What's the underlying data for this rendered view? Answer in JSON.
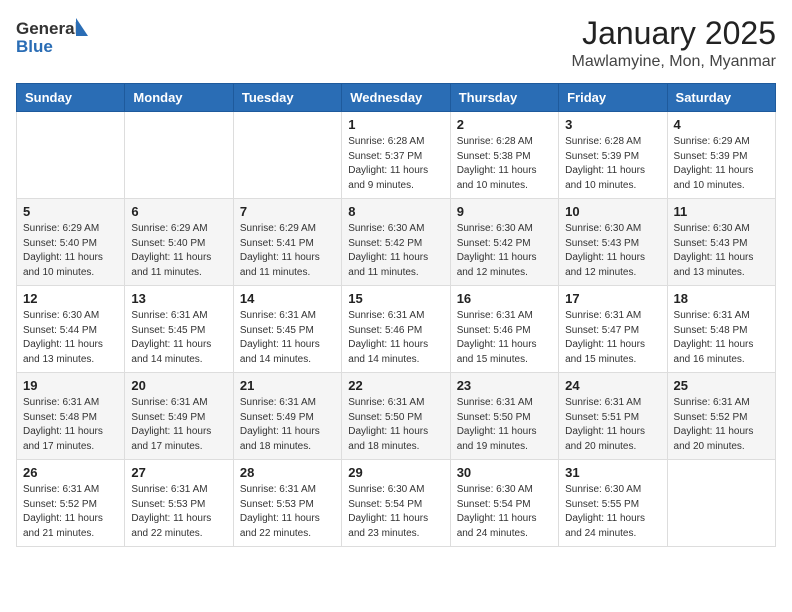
{
  "header": {
    "logo_general": "General",
    "logo_blue": "Blue",
    "month_title": "January 2025",
    "location": "Mawlamyine, Mon, Myanmar"
  },
  "weekdays": [
    "Sunday",
    "Monday",
    "Tuesday",
    "Wednesday",
    "Thursday",
    "Friday",
    "Saturday"
  ],
  "weeks": [
    [
      {
        "day": "",
        "sunrise": "",
        "sunset": "",
        "daylight": ""
      },
      {
        "day": "",
        "sunrise": "",
        "sunset": "",
        "daylight": ""
      },
      {
        "day": "",
        "sunrise": "",
        "sunset": "",
        "daylight": ""
      },
      {
        "day": "1",
        "sunrise": "Sunrise: 6:28 AM",
        "sunset": "Sunset: 5:37 PM",
        "daylight": "Daylight: 11 hours and 9 minutes."
      },
      {
        "day": "2",
        "sunrise": "Sunrise: 6:28 AM",
        "sunset": "Sunset: 5:38 PM",
        "daylight": "Daylight: 11 hours and 10 minutes."
      },
      {
        "day": "3",
        "sunrise": "Sunrise: 6:28 AM",
        "sunset": "Sunset: 5:39 PM",
        "daylight": "Daylight: 11 hours and 10 minutes."
      },
      {
        "day": "4",
        "sunrise": "Sunrise: 6:29 AM",
        "sunset": "Sunset: 5:39 PM",
        "daylight": "Daylight: 11 hours and 10 minutes."
      }
    ],
    [
      {
        "day": "5",
        "sunrise": "Sunrise: 6:29 AM",
        "sunset": "Sunset: 5:40 PM",
        "daylight": "Daylight: 11 hours and 10 minutes."
      },
      {
        "day": "6",
        "sunrise": "Sunrise: 6:29 AM",
        "sunset": "Sunset: 5:40 PM",
        "daylight": "Daylight: 11 hours and 11 minutes."
      },
      {
        "day": "7",
        "sunrise": "Sunrise: 6:29 AM",
        "sunset": "Sunset: 5:41 PM",
        "daylight": "Daylight: 11 hours and 11 minutes."
      },
      {
        "day": "8",
        "sunrise": "Sunrise: 6:30 AM",
        "sunset": "Sunset: 5:42 PM",
        "daylight": "Daylight: 11 hours and 11 minutes."
      },
      {
        "day": "9",
        "sunrise": "Sunrise: 6:30 AM",
        "sunset": "Sunset: 5:42 PM",
        "daylight": "Daylight: 11 hours and 12 minutes."
      },
      {
        "day": "10",
        "sunrise": "Sunrise: 6:30 AM",
        "sunset": "Sunset: 5:43 PM",
        "daylight": "Daylight: 11 hours and 12 minutes."
      },
      {
        "day": "11",
        "sunrise": "Sunrise: 6:30 AM",
        "sunset": "Sunset: 5:43 PM",
        "daylight": "Daylight: 11 hours and 13 minutes."
      }
    ],
    [
      {
        "day": "12",
        "sunrise": "Sunrise: 6:30 AM",
        "sunset": "Sunset: 5:44 PM",
        "daylight": "Daylight: 11 hours and 13 minutes."
      },
      {
        "day": "13",
        "sunrise": "Sunrise: 6:31 AM",
        "sunset": "Sunset: 5:45 PM",
        "daylight": "Daylight: 11 hours and 14 minutes."
      },
      {
        "day": "14",
        "sunrise": "Sunrise: 6:31 AM",
        "sunset": "Sunset: 5:45 PM",
        "daylight": "Daylight: 11 hours and 14 minutes."
      },
      {
        "day": "15",
        "sunrise": "Sunrise: 6:31 AM",
        "sunset": "Sunset: 5:46 PM",
        "daylight": "Daylight: 11 hours and 14 minutes."
      },
      {
        "day": "16",
        "sunrise": "Sunrise: 6:31 AM",
        "sunset": "Sunset: 5:46 PM",
        "daylight": "Daylight: 11 hours and 15 minutes."
      },
      {
        "day": "17",
        "sunrise": "Sunrise: 6:31 AM",
        "sunset": "Sunset: 5:47 PM",
        "daylight": "Daylight: 11 hours and 15 minutes."
      },
      {
        "day": "18",
        "sunrise": "Sunrise: 6:31 AM",
        "sunset": "Sunset: 5:48 PM",
        "daylight": "Daylight: 11 hours and 16 minutes."
      }
    ],
    [
      {
        "day": "19",
        "sunrise": "Sunrise: 6:31 AM",
        "sunset": "Sunset: 5:48 PM",
        "daylight": "Daylight: 11 hours and 17 minutes."
      },
      {
        "day": "20",
        "sunrise": "Sunrise: 6:31 AM",
        "sunset": "Sunset: 5:49 PM",
        "daylight": "Daylight: 11 hours and 17 minutes."
      },
      {
        "day": "21",
        "sunrise": "Sunrise: 6:31 AM",
        "sunset": "Sunset: 5:49 PM",
        "daylight": "Daylight: 11 hours and 18 minutes."
      },
      {
        "day": "22",
        "sunrise": "Sunrise: 6:31 AM",
        "sunset": "Sunset: 5:50 PM",
        "daylight": "Daylight: 11 hours and 18 minutes."
      },
      {
        "day": "23",
        "sunrise": "Sunrise: 6:31 AM",
        "sunset": "Sunset: 5:50 PM",
        "daylight": "Daylight: 11 hours and 19 minutes."
      },
      {
        "day": "24",
        "sunrise": "Sunrise: 6:31 AM",
        "sunset": "Sunset: 5:51 PM",
        "daylight": "Daylight: 11 hours and 20 minutes."
      },
      {
        "day": "25",
        "sunrise": "Sunrise: 6:31 AM",
        "sunset": "Sunset: 5:52 PM",
        "daylight": "Daylight: 11 hours and 20 minutes."
      }
    ],
    [
      {
        "day": "26",
        "sunrise": "Sunrise: 6:31 AM",
        "sunset": "Sunset: 5:52 PM",
        "daylight": "Daylight: 11 hours and 21 minutes."
      },
      {
        "day": "27",
        "sunrise": "Sunrise: 6:31 AM",
        "sunset": "Sunset: 5:53 PM",
        "daylight": "Daylight: 11 hours and 22 minutes."
      },
      {
        "day": "28",
        "sunrise": "Sunrise: 6:31 AM",
        "sunset": "Sunset: 5:53 PM",
        "daylight": "Daylight: 11 hours and 22 minutes."
      },
      {
        "day": "29",
        "sunrise": "Sunrise: 6:30 AM",
        "sunset": "Sunset: 5:54 PM",
        "daylight": "Daylight: 11 hours and 23 minutes."
      },
      {
        "day": "30",
        "sunrise": "Sunrise: 6:30 AM",
        "sunset": "Sunset: 5:54 PM",
        "daylight": "Daylight: 11 hours and 24 minutes."
      },
      {
        "day": "31",
        "sunrise": "Sunrise: 6:30 AM",
        "sunset": "Sunset: 5:55 PM",
        "daylight": "Daylight: 11 hours and 24 minutes."
      },
      {
        "day": "",
        "sunrise": "",
        "sunset": "",
        "daylight": ""
      }
    ]
  ]
}
